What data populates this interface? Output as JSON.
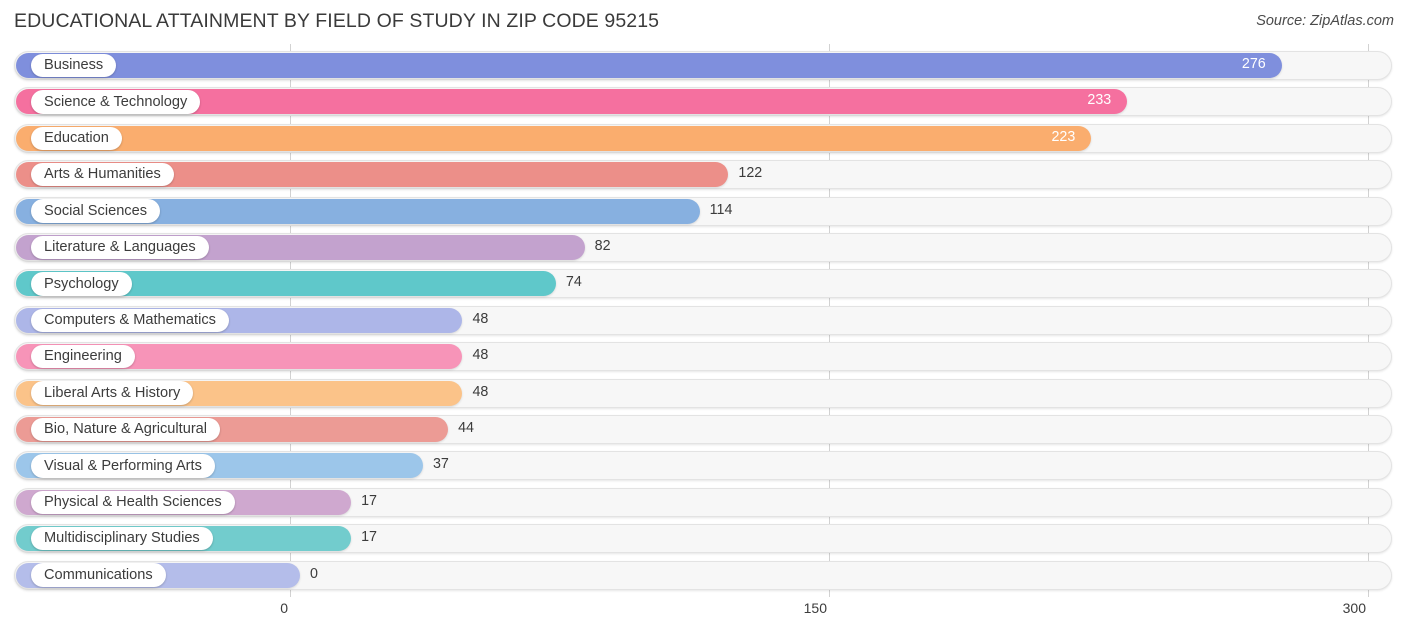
{
  "header": {
    "title": "EDUCATIONAL ATTAINMENT BY FIELD OF STUDY IN ZIP CODE 95215",
    "source": "Source: ZipAtlas.com"
  },
  "chart_data": {
    "type": "bar",
    "orientation": "horizontal",
    "title": "EDUCATIONAL ATTAINMENT BY FIELD OF STUDY IN ZIP CODE 95215",
    "xlabel": "",
    "ylabel": "",
    "xlim": [
      0,
      300
    ],
    "xticks": [
      0,
      150,
      300
    ],
    "xtick_labels": [
      "0",
      "150",
      "300"
    ],
    "grid": true,
    "legend": false,
    "categories": [
      "Business",
      "Science & Technology",
      "Education",
      "Arts & Humanities",
      "Social Sciences",
      "Literature & Languages",
      "Psychology",
      "Computers & Mathematics",
      "Engineering",
      "Liberal Arts & History",
      "Bio, Nature & Agricultural",
      "Visual & Performing Arts",
      "Physical & Health Sciences",
      "Multidisciplinary Studies",
      "Communications"
    ],
    "values": [
      276,
      233,
      223,
      122,
      114,
      82,
      74,
      48,
      48,
      48,
      44,
      37,
      17,
      17,
      0
    ],
    "value_labels": [
      "276",
      "233",
      "223",
      "122",
      "114",
      "82",
      "74",
      "48",
      "48",
      "48",
      "44",
      "37",
      "17",
      "17",
      "0"
    ],
    "label_placement": [
      "inside",
      "inside",
      "inside",
      "outside",
      "outside",
      "outside",
      "outside",
      "outside",
      "outside",
      "outside",
      "outside",
      "outside",
      "outside",
      "outside",
      "outside"
    ],
    "colors": [
      "#7f8fdd",
      "#f5709f",
      "#faad6e",
      "#ec8f89",
      "#87b0e0",
      "#c3a2ce",
      "#5fc8ca",
      "#adb6e8",
      "#f794b8",
      "#fbc389",
      "#ec9b95",
      "#9cc6ea",
      "#cfa8cf",
      "#72cccd",
      "#b4bdea"
    ]
  }
}
